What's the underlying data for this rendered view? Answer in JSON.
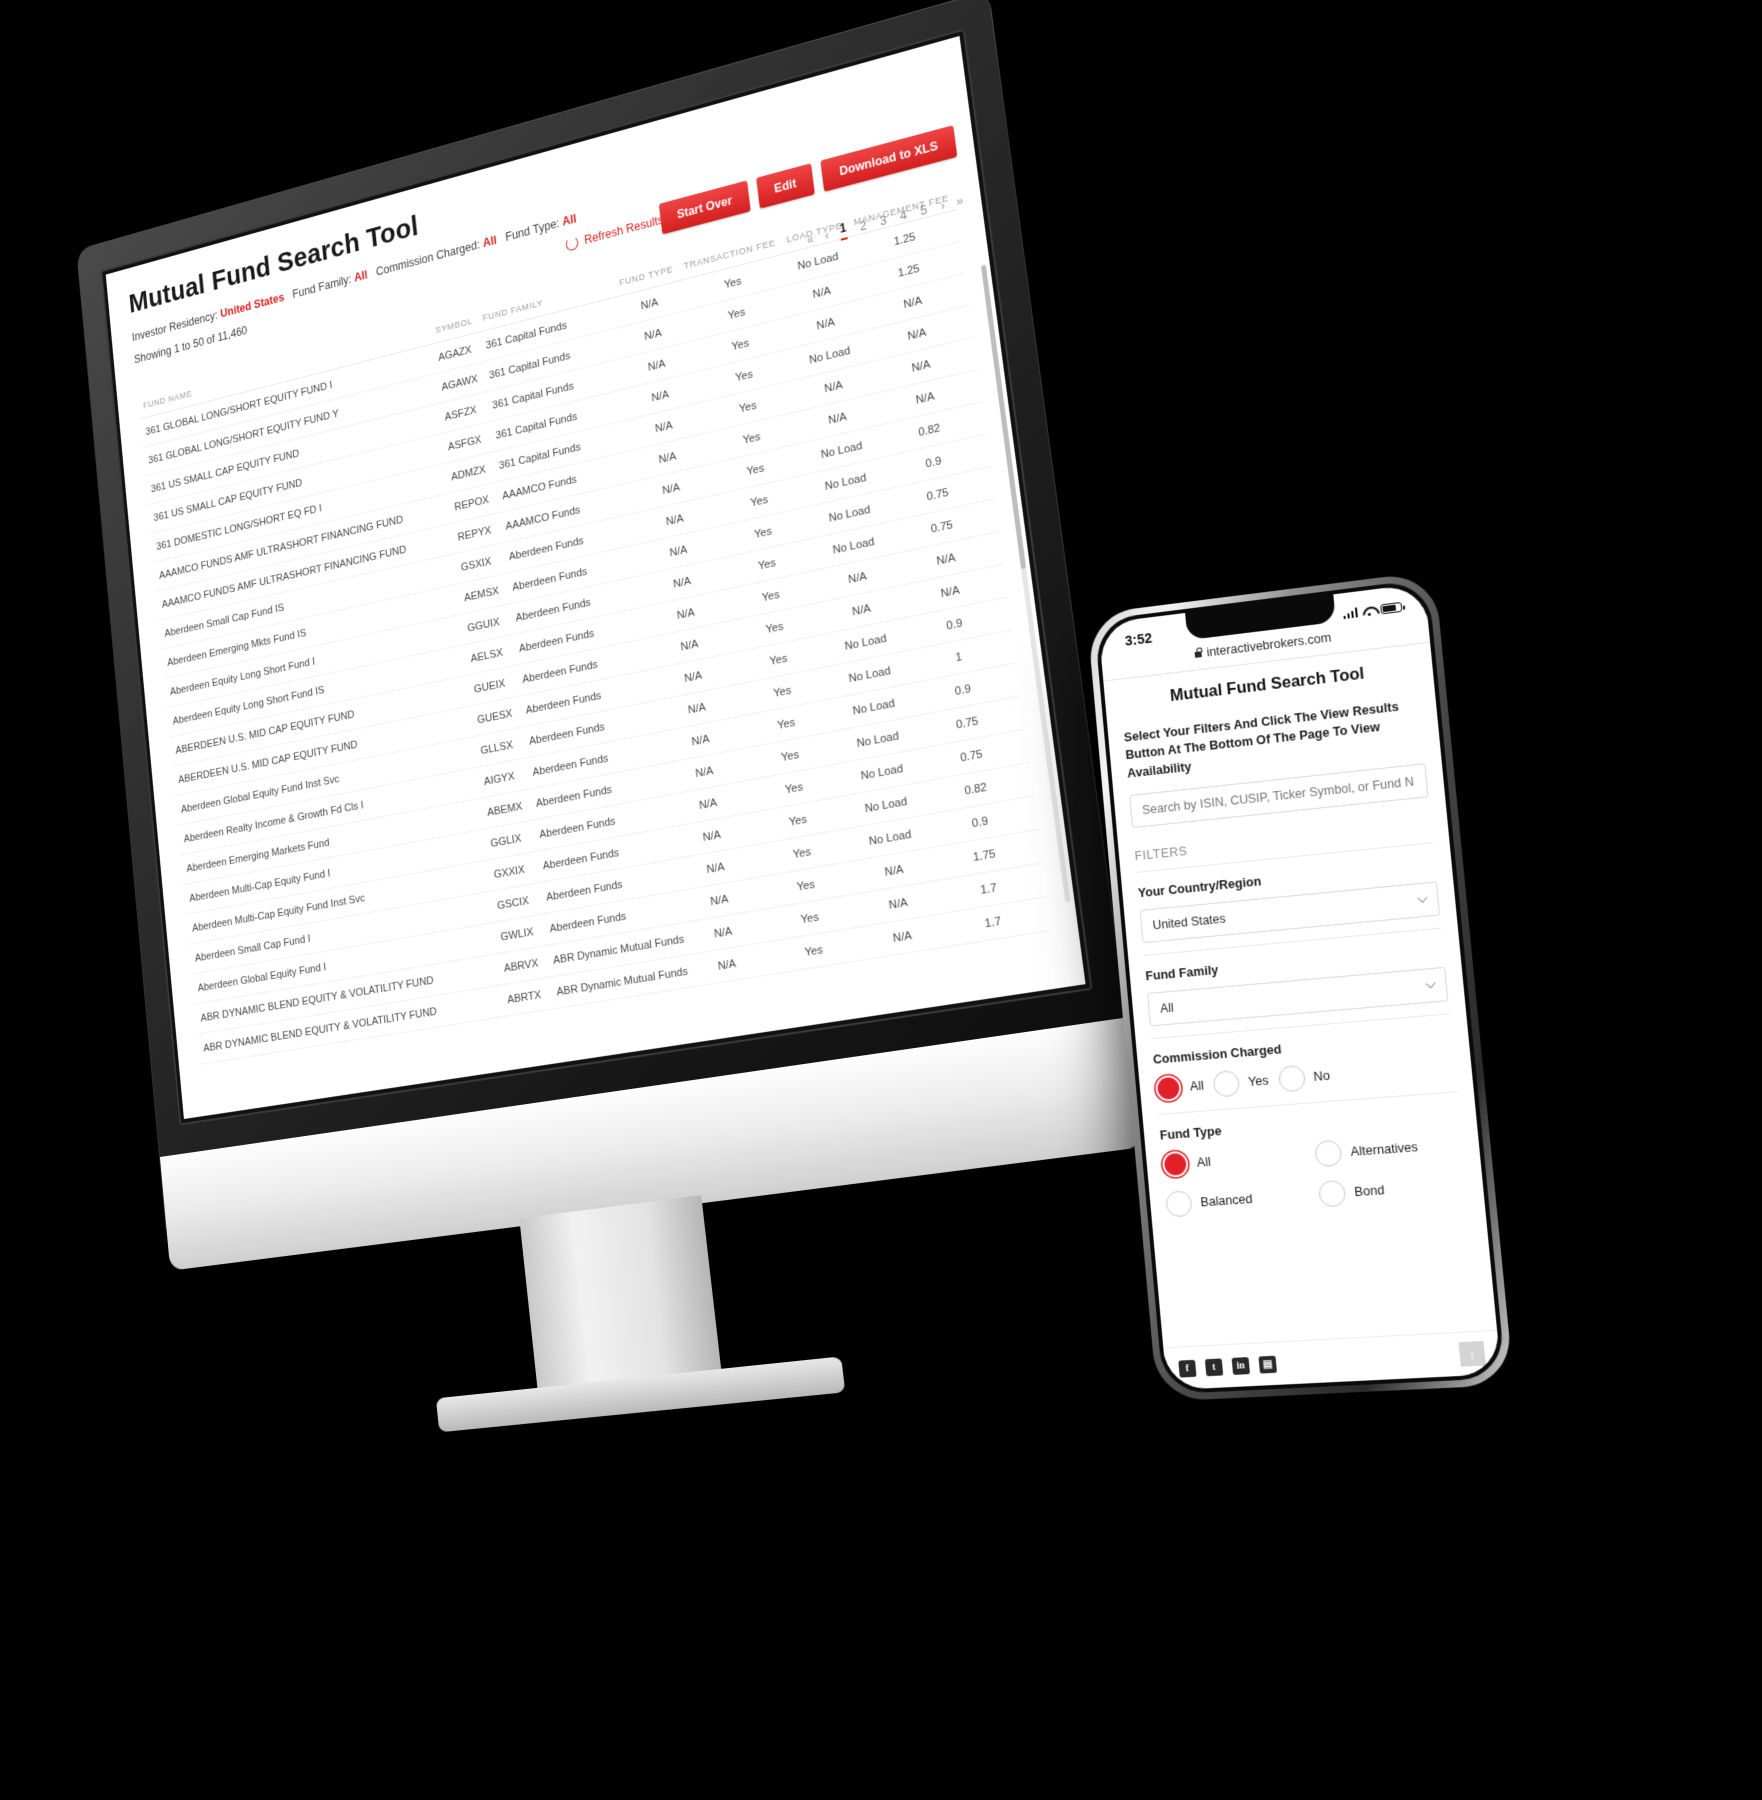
{
  "desktop": {
    "page_title": "Mutual Fund Search Tool",
    "filters_line": [
      {
        "label": "Investor Residency:",
        "value": "United States"
      },
      {
        "label": "Fund Family:",
        "value": "All"
      },
      {
        "label": "Commission Charged:",
        "value": "All"
      },
      {
        "label": "Fund Type:",
        "value": "All"
      }
    ],
    "showing": "Showing 1 to 50 of 11,460",
    "refresh_label": "Refresh Results",
    "buttons": {
      "start_over": "Start Over",
      "edit": "Edit",
      "download": "Download to XLS"
    },
    "pagination": {
      "first": "«",
      "prev": "‹",
      "pages": [
        "1",
        "2",
        "3",
        "4",
        "5"
      ],
      "active": "1",
      "next": "›",
      "last": "»"
    },
    "table": {
      "columns": [
        "FUND NAME",
        "SYMBOL",
        "FUND FAMILY",
        "FUND TYPE",
        "TRANSACTION FEE",
        "LOAD TYPE",
        "MANAGEMENT FEE"
      ],
      "rows": [
        [
          "361 GLOBAL LONG/SHORT EQUITY FUND I",
          "AGAZX",
          "361 Capital Funds",
          "N/A",
          "Yes",
          "No Load",
          "1.25"
        ],
        [
          "361 GLOBAL LONG/SHORT EQUITY FUND Y",
          "AGAWX",
          "361 Capital Funds",
          "N/A",
          "Yes",
          "N/A",
          "1.25"
        ],
        [
          "361 US SMALL CAP EQUITY FUND",
          "ASFZX",
          "361 Capital Funds",
          "N/A",
          "Yes",
          "N/A",
          "N/A"
        ],
        [
          "361 US SMALL CAP EQUITY FUND",
          "ASFGX",
          "361 Capital Funds",
          "N/A",
          "Yes",
          "No Load",
          "N/A"
        ],
        [
          "361 DOMESTIC LONG/SHORT EQ FD I",
          "ADMZX",
          "361 Capital Funds",
          "N/A",
          "Yes",
          "N/A",
          "N/A"
        ],
        [
          "AAAMCO FUNDS AMF ULTRASHORT FINANCING FUND",
          "REPOX",
          "AAAMCO Funds",
          "N/A",
          "Yes",
          "N/A",
          "N/A"
        ],
        [
          "AAAMCO FUNDS AMF ULTRASHORT FINANCING FUND",
          "REPYX",
          "AAAMCO Funds",
          "N/A",
          "Yes",
          "No Load",
          "0.82"
        ],
        [
          "Aberdeen Small Cap Fund IS",
          "GSXIX",
          "Aberdeen Funds",
          "N/A",
          "Yes",
          "No Load",
          "0.9"
        ],
        [
          "Aberdeen Emerging Mkts Fund IS",
          "AEMSX",
          "Aberdeen Funds",
          "N/A",
          "Yes",
          "No Load",
          "0.75"
        ],
        [
          "Aberdeen Equity Long Short Fund I",
          "GGUIX",
          "Aberdeen Funds",
          "N/A",
          "Yes",
          "No Load",
          "0.75"
        ],
        [
          "Aberdeen Equity Long Short Fund IS",
          "AELSX",
          "Aberdeen Funds",
          "N/A",
          "Yes",
          "N/A",
          "N/A"
        ],
        [
          "ABERDEEN U.S. MID CAP EQUITY FUND",
          "GUEIX",
          "Aberdeen Funds",
          "N/A",
          "Yes",
          "N/A",
          "N/A"
        ],
        [
          "ABERDEEN U.S. MID CAP EQUITY FUND",
          "GUESX",
          "Aberdeen Funds",
          "N/A",
          "Yes",
          "No Load",
          "0.9"
        ],
        [
          "Aberdeen Global Equity Fund Inst Svc",
          "GLLSX",
          "Aberdeen Funds",
          "N/A",
          "Yes",
          "No Load",
          "1"
        ],
        [
          "Aberdeen Realty Income & Growth Fd Cls I",
          "AIGYX",
          "Aberdeen Funds",
          "N/A",
          "Yes",
          "No Load",
          "0.9"
        ],
        [
          "Aberdeen Emerging Markets Fund",
          "ABEMX",
          "Aberdeen Funds",
          "N/A",
          "Yes",
          "No Load",
          "0.75"
        ],
        [
          "Aberdeen Multi-Cap Equity Fund I",
          "GGLIX",
          "Aberdeen Funds",
          "N/A",
          "Yes",
          "No Load",
          "0.75"
        ],
        [
          "Aberdeen Multi-Cap Equity Fund Inst Svc",
          "GXXIX",
          "Aberdeen Funds",
          "N/A",
          "Yes",
          "No Load",
          "0.82"
        ],
        [
          "Aberdeen Small Cap Fund I",
          "GSCIX",
          "Aberdeen Funds",
          "N/A",
          "Yes",
          "No Load",
          "0.9"
        ],
        [
          "Aberdeen Global Equity Fund I",
          "GWLIX",
          "Aberdeen Funds",
          "N/A",
          "Yes",
          "N/A",
          "1.75"
        ],
        [
          "ABR DYNAMIC BLEND EQUITY & VOLATILITY FUND",
          "ABRVX",
          "ABR Dynamic Mutual Funds",
          "N/A",
          "Yes",
          "N/A",
          "1.7"
        ],
        [
          "ABR DYNAMIC BLEND EQUITY & VOLATILITY FUND",
          "ABRTX",
          "ABR Dynamic Mutual Funds",
          "N/A",
          "Yes",
          "N/A",
          "1.7"
        ]
      ]
    }
  },
  "phone": {
    "status": {
      "time": "3:52",
      "location_arrow": "➤"
    },
    "url": "interactivebrokers.com",
    "title": "Mutual Fund Search Tool",
    "subtitle": "Select Your Filters And Click The View Results Button At The Bottom Of The Page To View Availability",
    "search_placeholder": "Search by ISIN, CUSIP, Ticker Symbol, or Fund Name",
    "filters_heading": "FILTERS",
    "country": {
      "label": "Your Country/Region",
      "value": "United States"
    },
    "fund_family": {
      "label": "Fund Family",
      "value": "All"
    },
    "commission": {
      "label": "Commission Charged",
      "options": [
        {
          "label": "All",
          "selected": true
        },
        {
          "label": "Yes",
          "selected": false
        },
        {
          "label": "No",
          "selected": false
        }
      ]
    },
    "fund_type": {
      "label": "Fund Type",
      "options": [
        {
          "label": "All",
          "selected": true
        },
        {
          "label": "Alternatives",
          "selected": false
        },
        {
          "label": "Balanced",
          "selected": false
        },
        {
          "label": "Bond",
          "selected": false
        }
      ]
    },
    "social": [
      "f",
      "t",
      "in",
      "▤"
    ],
    "to_top": "↑"
  },
  "colors": {
    "accent_red": "#e2202a",
    "button_red": "#d41f1f",
    "background": "#000000"
  }
}
